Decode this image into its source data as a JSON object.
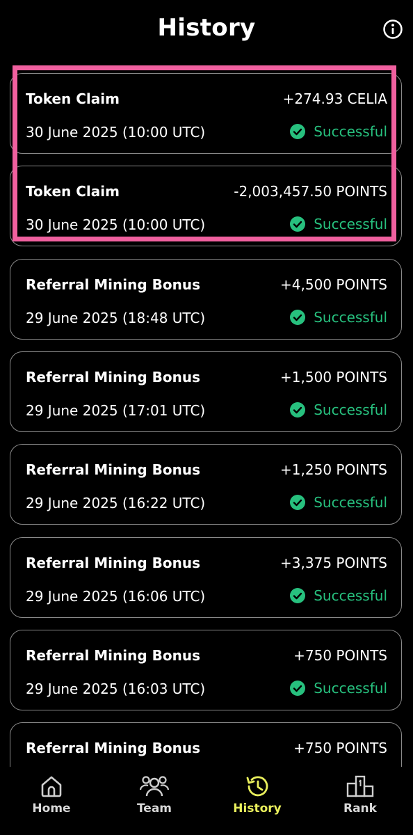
{
  "header": {
    "title": "History",
    "info_icon": "info-icon"
  },
  "transactions": [
    {
      "name": "Token Claim",
      "amount": "+274.93 CELIA",
      "date": "30 June 2025 (10:00 UTC)",
      "status": "Successful"
    },
    {
      "name": "Token Claim",
      "amount": "-2,003,457.50 POINTS",
      "date": "30 June 2025 (10:00 UTC)",
      "status": "Successful"
    },
    {
      "name": "Referral Mining Bonus",
      "amount": "+4,500 POINTS",
      "date": "29 June 2025 (18:48 UTC)",
      "status": "Successful"
    },
    {
      "name": "Referral Mining Bonus",
      "amount": "+1,500 POINTS",
      "date": "29 June 2025 (17:01 UTC)",
      "status": "Successful"
    },
    {
      "name": "Referral Mining Bonus",
      "amount": "+1,250 POINTS",
      "date": "29 June 2025 (16:22 UTC)",
      "status": "Successful"
    },
    {
      "name": "Referral Mining Bonus",
      "amount": "+3,375 POINTS",
      "date": "29 June 2025 (16:06 UTC)",
      "status": "Successful"
    },
    {
      "name": "Referral Mining Bonus",
      "amount": "+750 POINTS",
      "date": "29 June 2025 (16:03 UTC)",
      "status": "Successful"
    },
    {
      "name": "Referral Mining Bonus",
      "amount": "+750 POINTS",
      "date": "",
      "status": ""
    }
  ],
  "nav": {
    "items": [
      {
        "label": "Home",
        "icon": "home-icon",
        "active": false
      },
      {
        "label": "Team",
        "icon": "team-icon",
        "active": false
      },
      {
        "label": "History",
        "icon": "history-icon",
        "active": true
      },
      {
        "label": "Rank",
        "icon": "rank-icon",
        "active": false
      }
    ]
  },
  "colors": {
    "background": "#000000",
    "success": "#27c07e",
    "active_nav": "#e9ef5c",
    "highlight": "#f0609f",
    "card_border": "#8a8a8a"
  }
}
